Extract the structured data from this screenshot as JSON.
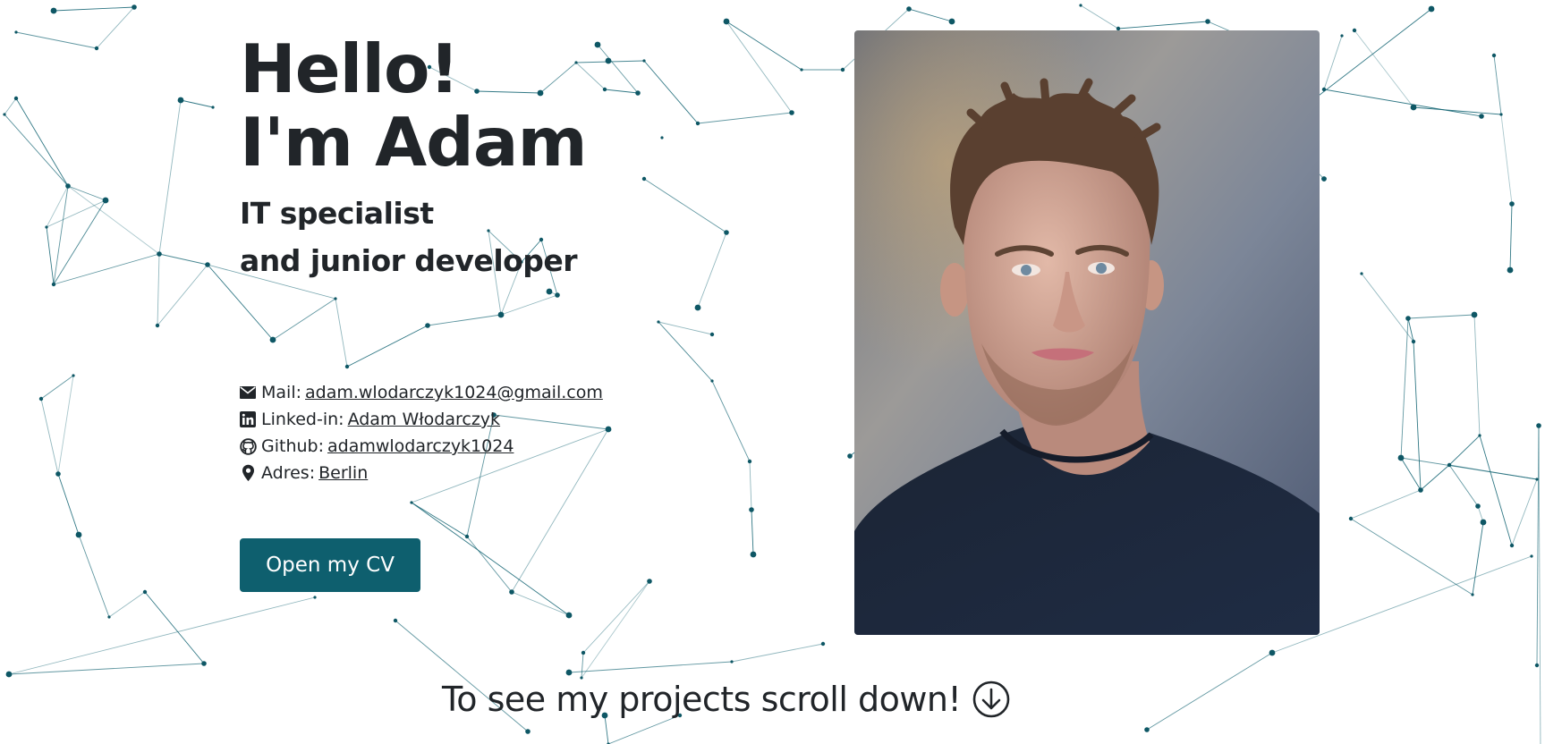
{
  "hero": {
    "greeting_line1": "Hello!",
    "greeting_line2": "I'm Adam",
    "subtitle_line1": "IT specialist",
    "subtitle_line2": "and junior developer"
  },
  "contacts": {
    "mail": {
      "label": "Mail:",
      "value": "adam.wlodarczyk1024@gmail.com",
      "icon": "envelope-icon"
    },
    "linkedin": {
      "label": "Linked-in:",
      "value": "Adam Włodarczyk",
      "icon": "linkedin-icon"
    },
    "github": {
      "label": "Github:",
      "value": "adamwlodarczyk1024",
      "icon": "github-icon"
    },
    "address": {
      "label": "Adres:",
      "value": "Berlin",
      "icon": "map-pin-icon"
    }
  },
  "cv_button": {
    "label": "Open my CV"
  },
  "scroll_hint": {
    "text": "To see my projects scroll down!",
    "icon": "arrow-down-circle-icon"
  },
  "colors": {
    "accent": "#0e5f6e",
    "text": "#212529",
    "network": "#0e6170",
    "background": "#ffffff"
  }
}
